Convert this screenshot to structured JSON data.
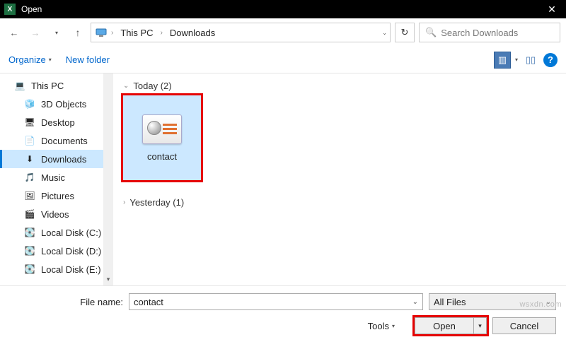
{
  "titlebar": {
    "app_icon_letter": "X",
    "title": "Open",
    "close_glyph": "✕"
  },
  "nav": {
    "back": "←",
    "forward": "→",
    "recent_chevron": "▾",
    "up": "↑",
    "breadcrumb": {
      "root_sep": "›",
      "loc1": "This PC",
      "loc2": "Downloads"
    },
    "addr_dropdown": "⌄",
    "refresh": "↻",
    "search_placeholder": "Search Downloads",
    "search_icon": "🔍"
  },
  "toolbar": {
    "organize": "Organize",
    "organize_dd": "▾",
    "new_folder": "New folder",
    "view_icon1": "▥",
    "view_dd": "▾",
    "view_icon2": "▯▯",
    "help": "?"
  },
  "sidebar": {
    "items": [
      {
        "label": "This PC",
        "icon": "💻"
      },
      {
        "label": "3D Objects",
        "icon": "🧊"
      },
      {
        "label": "Desktop",
        "icon": "🖥"
      },
      {
        "label": "Documents",
        "icon": "📄"
      },
      {
        "label": "Downloads",
        "icon": "⬇"
      },
      {
        "label": "Music",
        "icon": "🎵"
      },
      {
        "label": "Pictures",
        "icon": "🖼"
      },
      {
        "label": "Videos",
        "icon": "🎬"
      },
      {
        "label": "Local Disk (C:)",
        "icon": "💽"
      },
      {
        "label": "Local Disk (D:)",
        "icon": "💽"
      },
      {
        "label": "Local Disk (E:)",
        "icon": "💽"
      }
    ],
    "scroll_down": "▾"
  },
  "filearea": {
    "groups": [
      {
        "header": "Today (2)",
        "chevron": "⌄",
        "files": [
          {
            "name": "contact",
            "selected": true
          }
        ]
      },
      {
        "header": "Yesterday (1)",
        "chevron": "›",
        "files": []
      }
    ]
  },
  "footer": {
    "filename_label": "File name:",
    "filename_value": "contact",
    "filetype_value": "All Files",
    "tools_label": "Tools",
    "tools_dd": "▾",
    "open_label": "Open",
    "open_dd": "▾",
    "cancel_label": "Cancel"
  },
  "watermark": "wsxdn.com"
}
